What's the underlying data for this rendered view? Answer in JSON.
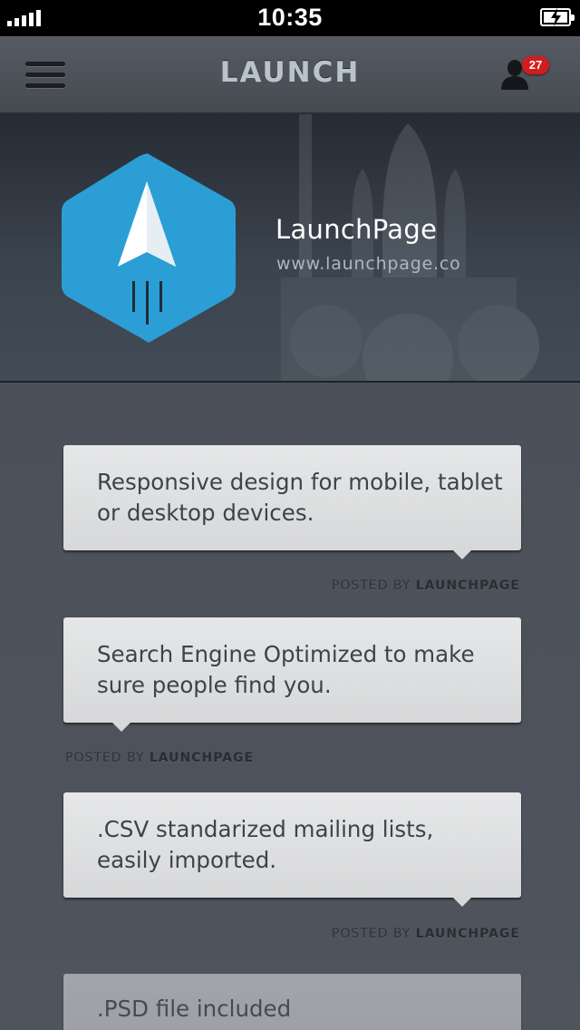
{
  "status_bar": {
    "time": "10:35"
  },
  "nav": {
    "title": "LAUNCH",
    "notification_count": "27"
  },
  "hero": {
    "app_name": "LaunchPage",
    "url": "www.launchpage.co"
  },
  "colors": {
    "accent_blue": "#2a9fd6",
    "badge_red": "#d21d1f"
  },
  "posts": [
    {
      "text": "Responsive design for mobile, tablet or desktop devices.",
      "posted_by_label": "POSTED BY",
      "author": "LAUNCHPAGE"
    },
    {
      "text": "Search Engine Optimized to make sure people find you.",
      "posted_by_label": "POSTED BY",
      "author": "LAUNCHPAGE"
    },
    {
      "text": ".CSV standarized mailing lists, easily imported.",
      "posted_by_label": "POSTED BY",
      "author": "LAUNCHPAGE"
    },
    {
      "text": ".PSD file included"
    }
  ]
}
